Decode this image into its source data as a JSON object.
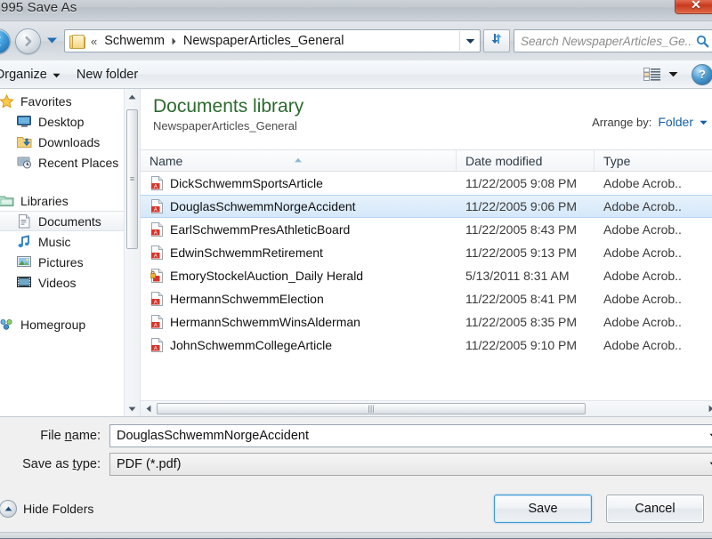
{
  "window": {
    "title": "995 Save As",
    "close_label": "✕"
  },
  "nav": {
    "back_icon": "back-arrow-icon",
    "forward_icon": "forward-arrow-icon",
    "history_icon": "chevron-down-icon",
    "folder_icon": "folder-icon",
    "overflow_chevrons": "«",
    "breadcrumbs": [
      "Schwemm",
      "NewspaperArticles_General"
    ],
    "breadcrumb_separator": "▸",
    "address_dropdown_icon": "chevron-down-icon",
    "refresh_icon": "refresh-icon",
    "search_placeholder": "Search NewspaperArticles_Ge...",
    "search_icon": "search-icon"
  },
  "toolbar": {
    "organize_label": "Organize",
    "organize_caret": "▼",
    "new_folder_label": "New folder",
    "view_icon": "view-list-icon",
    "view_caret": "▼",
    "help_label": "?"
  },
  "sidebar": {
    "groups": [
      {
        "header": {
          "label": "Favorites",
          "icon": "star-icon"
        },
        "items": [
          {
            "label": "Desktop",
            "icon": "desktop-icon",
            "selected": false
          },
          {
            "label": "Downloads",
            "icon": "downloads-icon",
            "selected": false
          },
          {
            "label": "Recent Places",
            "icon": "recent-places-icon",
            "selected": false
          }
        ]
      },
      {
        "header": {
          "label": "Libraries",
          "icon": "libraries-icon"
        },
        "items": [
          {
            "label": "Documents",
            "icon": "document-icon",
            "selected": true
          },
          {
            "label": "Music",
            "icon": "music-icon",
            "selected": false
          },
          {
            "label": "Pictures",
            "icon": "pictures-icon",
            "selected": false
          },
          {
            "label": "Videos",
            "icon": "videos-icon",
            "selected": false
          }
        ]
      },
      {
        "header": {
          "label": "Homegroup",
          "icon": "homegroup-icon"
        },
        "items": []
      }
    ]
  },
  "library": {
    "title": "Documents library",
    "subtitle": "NewspaperArticles_General",
    "arrange_label": "Arrange by:",
    "arrange_value": "Folder",
    "arrange_caret": "▼"
  },
  "filelist": {
    "columns": [
      "Name",
      "Date modified",
      "Type"
    ],
    "sort_indicator": "▲",
    "rows": [
      {
        "name": "DickSchwemmSportsArticle",
        "date": "11/22/2005 9:08 PM",
        "type": "Adobe Acrob..",
        "icon": "pdf-icon",
        "selected": false
      },
      {
        "name": "DouglasSchwemmNorgeAccident",
        "date": "11/22/2005 9:06 PM",
        "type": "Adobe Acrob..",
        "icon": "pdf-icon",
        "selected": true
      },
      {
        "name": "EarlSchwemmPresAthleticBoard",
        "date": "11/22/2005 8:43 PM",
        "type": "Adobe Acrob..",
        "icon": "pdf-icon",
        "selected": false
      },
      {
        "name": "EdwinSchwemmRetirement",
        "date": "11/22/2005 9:13 PM",
        "type": "Adobe Acrob..",
        "icon": "pdf-icon",
        "selected": false
      },
      {
        "name": "EmoryStockelAuction_Daily Herald",
        "date": "5/13/2011 8:31 AM",
        "type": "Adobe Acrob..",
        "icon": "pdf-locked-icon",
        "selected": false
      },
      {
        "name": "HermannSchwemmElection",
        "date": "11/22/2005 8:41 PM",
        "type": "Adobe Acrob..",
        "icon": "pdf-icon",
        "selected": false
      },
      {
        "name": "HermannSchwemmWinsAlderman",
        "date": "11/22/2005 8:35 PM",
        "type": "Adobe Acrob..",
        "icon": "pdf-icon",
        "selected": false
      },
      {
        "name": "JohnSchwemmCollegeArticle",
        "date": "11/22/2005 9:10 PM",
        "type": "Adobe Acrob..",
        "icon": "pdf-icon",
        "selected": false
      }
    ]
  },
  "form": {
    "filename_label_pre": "File ",
    "filename_label_accel": "n",
    "filename_label_post": "ame:",
    "filename_value": "DouglasSchwemmNorgeAccident",
    "savetype_label_pre": "Save as ",
    "savetype_label_accel": "t",
    "savetype_label_post": "ype:",
    "savetype_value": "PDF (*.pdf)",
    "dropdown_caret": "▼"
  },
  "footer": {
    "hide_folders_label": "Hide Folders",
    "hide_folders_icon": "chevron-up-circle-icon",
    "save_label": "Save",
    "cancel_label": "Cancel"
  },
  "colors": {
    "library_title": "#2c6a2f",
    "arrange_link": "#1560a8",
    "selection": "#d5e8fa",
    "default_button_border": "#3d9ad4",
    "close_button": "#c8391d"
  }
}
